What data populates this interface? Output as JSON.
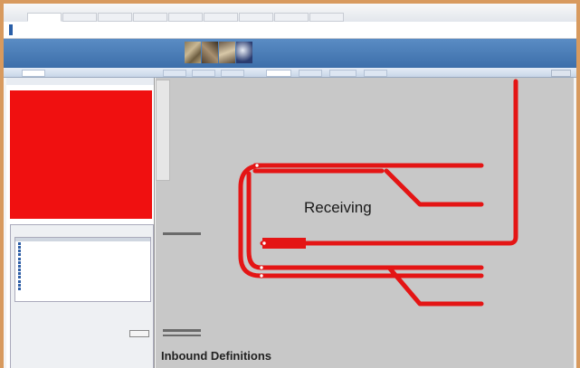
{
  "app": {
    "name": "",
    "site_title": "",
    "banner_title": "",
    "user_info": ""
  },
  "nav_tabs": [
    "",
    "",
    "",
    "",
    "",
    "",
    "",
    "",
    ""
  ],
  "page_tabs": [
    "",
    "",
    "",
    "",
    "",
    "",
    "",
    ""
  ],
  "alerts": [
    "",
    "",
    "",
    "",
    "",
    "",
    "",
    "",
    "",
    "",
    "",
    "",
    "",
    "",
    "",
    "",
    "",
    "",
    "",
    "",
    "",
    "",
    "",
    "",
    "",
    ""
  ],
  "sub_tabs": [
    "",
    ""
  ],
  "tree_items": [
    "",
    "",
    "",
    "",
    "",
    "",
    "",
    "",
    "",
    "",
    "",
    "",
    ""
  ],
  "options": [
    "",
    "",
    "",
    "",
    ""
  ],
  "diagram": {
    "area_label": "Receiving",
    "bottom_title": "Inbound Definitions",
    "track_labels": [
      "",
      "",
      "",
      "",
      "",
      "",
      ""
    ],
    "track_color": "#e41515"
  },
  "colors": {
    "banner": "#4a7cb8",
    "alert_bg": "#f01010",
    "page_bg": "#d89a5e"
  }
}
